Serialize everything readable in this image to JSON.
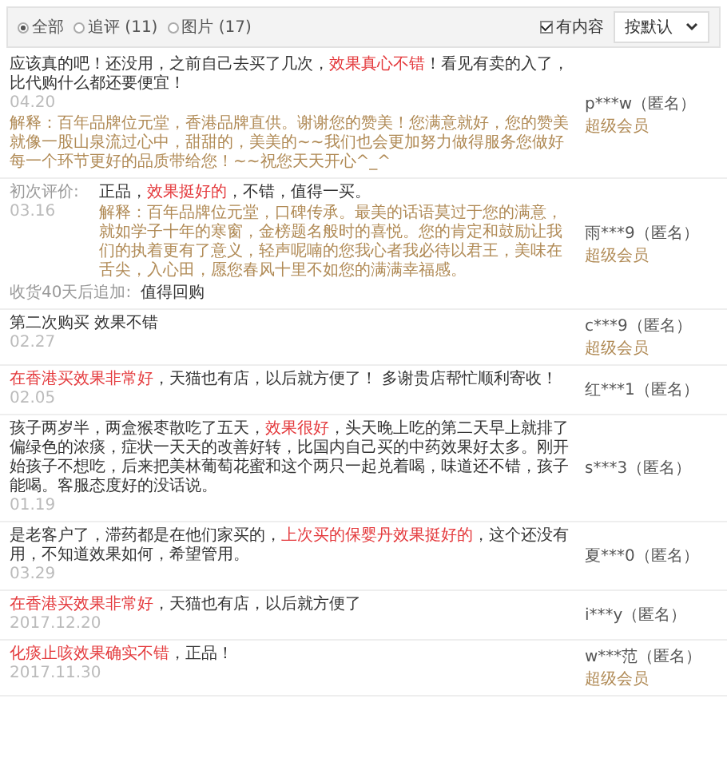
{
  "filters": [
    {
      "label": "全部",
      "selected": true
    },
    {
      "label": "追评 (11)",
      "selected": false
    },
    {
      "label": "图片 (17)",
      "selected": false
    }
  ],
  "has_content": {
    "label": "有内容",
    "checked": true
  },
  "sort": {
    "value": "按默认"
  },
  "reviews": [
    {
      "content": [
        {
          "text": "应该真的吧！还没用，之前自己去买了几次，",
          "highlight": false
        },
        {
          "text": "效果真心不错",
          "highlight": true
        },
        {
          "text": "！看见有卖的入了，比代购什么都还要便宜！",
          "highlight": false
        }
      ],
      "date": "04.20",
      "reply": "解释：百年品牌位元堂，香港品牌直供。谢谢您的赞美！您满意就好，您的赞美就像一股山泉流过心中，甜甜的，美美的~~我们也会更加努力做得服务您做好每一个环节更好的品质带给您！~~祝您天天开心^_^",
      "user": "p***w（匿名）",
      "member": "超级会员"
    },
    {
      "label": "初次评价:",
      "content": [
        {
          "text": "正品，",
          "highlight": false
        },
        {
          "text": "效果挺好的",
          "highlight": true
        },
        {
          "text": "，不错，值得一买。",
          "highlight": false
        }
      ],
      "date": "03.16",
      "reply": "解释：百年品牌位元堂，口碑传承。最美的话语莫过于您的满意，就如学子十年的寒窗，金榜题名般时的喜悦。您的肯定和鼓励让我们的执着更有了意义，轻声呢喃的您我心者我必待以君王，美味在舌尖，入心田，愿您春风十里不如您的满满幸福感。",
      "user": "雨***9（匿名）",
      "member": "超级会员",
      "append": {
        "label": "收货40天后追加:",
        "text": "值得回购"
      }
    },
    {
      "content": [
        {
          "text": "第二次购买 效果不错",
          "highlight": false
        }
      ],
      "date": "02.27",
      "user": "c***9（匿名）",
      "member": "超级会员"
    },
    {
      "content": [
        {
          "text": "在香港买效果非常好",
          "highlight": true
        },
        {
          "text": "，天猫也有店，以后就方便了！ 多谢贵店帮忙顺利寄收！",
          "highlight": false
        }
      ],
      "date": "02.05",
      "user": "红***1（匿名）"
    },
    {
      "content": [
        {
          "text": "孩子两岁半，两盒猴枣散吃了五天，",
          "highlight": false
        },
        {
          "text": "效果很好",
          "highlight": true
        },
        {
          "text": "，头天晚上吃的第二天早上就排了偏绿色的浓痰，症状一天天的改善好转，比国内自己买的中药效果好太多。刚开始孩子不想吃，后来把美林葡萄花蜜和这个两只一起兑着喝，味道还不错，孩子能喝。客服态度好的没话说。",
          "highlight": false
        }
      ],
      "date": "01.19",
      "user": "s***3（匿名）"
    },
    {
      "content": [
        {
          "text": "是老客户了，滞药都是在他们家买的，",
          "highlight": false
        },
        {
          "text": "上次买的保婴丹效果挺好的",
          "highlight": true
        },
        {
          "text": "，这个还没有用，不知道效果如何，希望管用。",
          "highlight": false
        }
      ],
      "date": "03.29",
      "user": "夏***0（匿名）"
    },
    {
      "content": [
        {
          "text": "在香港买效果非常好",
          "highlight": true
        },
        {
          "text": "，天猫也有店，以后就方便了",
          "highlight": false
        }
      ],
      "date": "2017.12.20",
      "user": "i***y（匿名）"
    },
    {
      "content": [
        {
          "text": "化痰止咳效果确实不错",
          "highlight": true
        },
        {
          "text": "，正品！",
          "highlight": false
        }
      ],
      "date": "2017.11.30",
      "user": "w***范（匿名）",
      "member": "超级会员"
    }
  ]
}
